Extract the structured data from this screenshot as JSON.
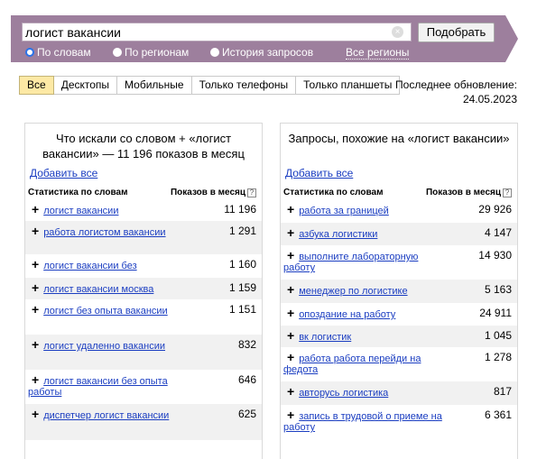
{
  "search": {
    "query": "логист вакансии",
    "clear_icon": "clear-icon",
    "submit_label": "Подобрать"
  },
  "modes": [
    {
      "label": "По словам",
      "checked": true
    },
    {
      "label": "По регионам",
      "checked": false
    },
    {
      "label": "История запросов",
      "checked": false
    }
  ],
  "all_regions_label": "Все регионы",
  "device_tabs": [
    {
      "label": "Все",
      "active": true
    },
    {
      "label": "Десктопы",
      "active": false
    },
    {
      "label": "Мобильные",
      "active": false
    },
    {
      "label": "Только телефоны",
      "active": false
    },
    {
      "label": "Только планшеты",
      "active": false
    }
  ],
  "last_update": "Последнее обновление: 24.05.2023",
  "left_panel": {
    "title": "Что искали со словом + «логист вакансии» — 11 196 показов в месяц",
    "add_all": "Добавить все",
    "col_phrase": "Статистика по словам",
    "col_count": "Показов в месяц",
    "rows": [
      {
        "phrase": "логист вакансии",
        "count": "11 196"
      },
      {
        "phrase": "работа логистом вакансии",
        "count": "1 291"
      },
      {
        "phrase": "логист вакансии без",
        "count": "1 160"
      },
      {
        "phrase": "логист вакансии москва",
        "count": "1 159"
      },
      {
        "phrase": "логист без опыта вакансии",
        "count": "1 151"
      },
      {
        "phrase": "логист удаленно вакансии",
        "count": "832"
      },
      {
        "phrase": "логист вакансии без опыта работы",
        "count": "646"
      },
      {
        "phrase": "диспетчер логист вакансии",
        "count": "625"
      }
    ]
  },
  "right_panel": {
    "title": "Запросы, похожие на «логист вакансии»",
    "add_all": "Добавить все",
    "col_phrase": "Статистика по словам",
    "col_count": "Показов в месяц",
    "rows": [
      {
        "phrase": "работа за границей",
        "count": "29 926"
      },
      {
        "phrase": "азбука логистики",
        "count": "4 147"
      },
      {
        "phrase": "выполните лабораторную работу",
        "count": "14 930"
      },
      {
        "phrase": "менеджер по логистике",
        "count": "5 163"
      },
      {
        "phrase": "опоздание на работу",
        "count": "24 911"
      },
      {
        "phrase": "вк логистик",
        "count": "1 045"
      },
      {
        "phrase": "работа работа перейди на федота",
        "count": "1 278"
      },
      {
        "phrase": "авторусь логистика",
        "count": "817"
      },
      {
        "phrase": "запись в трудовой о приеме на работу",
        "count": "6 361"
      }
    ]
  },
  "colors": {
    "banner": "#9d7f9d",
    "link": "#1a3dc1",
    "active_tab": "#fde9a5",
    "row_alt": "#f1f1f1"
  }
}
